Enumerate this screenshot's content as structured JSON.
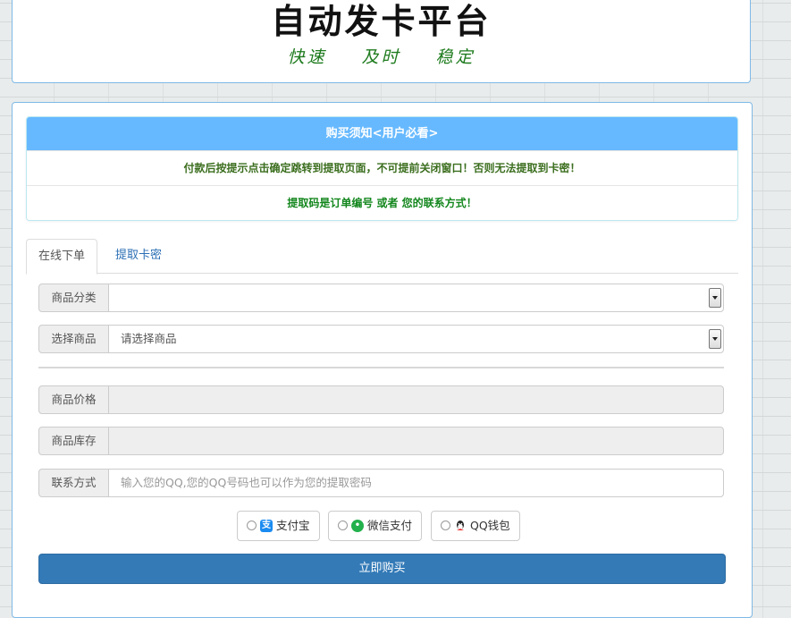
{
  "header": {
    "title": "自动发卡平台",
    "slogan": "快速 及时 稳定"
  },
  "notice": {
    "title": "购买须知<用户必看>",
    "line1": "付款后按提示点击确定跳转到提取页面，不可提前关闭窗口！否则无法提取到卡密！",
    "line2": "提取码是订单编号 或者 您的联系方式！",
    "colors": {
      "title_bg": "#66b9ff",
      "line1": "#3b6e1e",
      "line2": "#14871e"
    }
  },
  "tabs": [
    {
      "label": "在线下单",
      "active": true
    },
    {
      "label": "提取卡密",
      "active": false
    }
  ],
  "form": {
    "category": {
      "label": "商品分类",
      "value": ""
    },
    "product": {
      "label": "选择商品",
      "value": "请选择商品"
    },
    "price": {
      "label": "商品价格",
      "value": ""
    },
    "stock": {
      "label": "商品库存",
      "value": ""
    },
    "contact": {
      "label": "联系方式",
      "placeholder": "输入您的QQ,您的QQ号码也可以作为您的提取密码"
    }
  },
  "payment": {
    "options": [
      {
        "label": "支付宝",
        "icon": "alipay-icon"
      },
      {
        "label": "微信支付",
        "icon": "wechat-icon"
      },
      {
        "label": "QQ钱包",
        "icon": "qq-icon"
      }
    ]
  },
  "buy_button": {
    "label": "立即购买",
    "color": "#337ab7"
  }
}
